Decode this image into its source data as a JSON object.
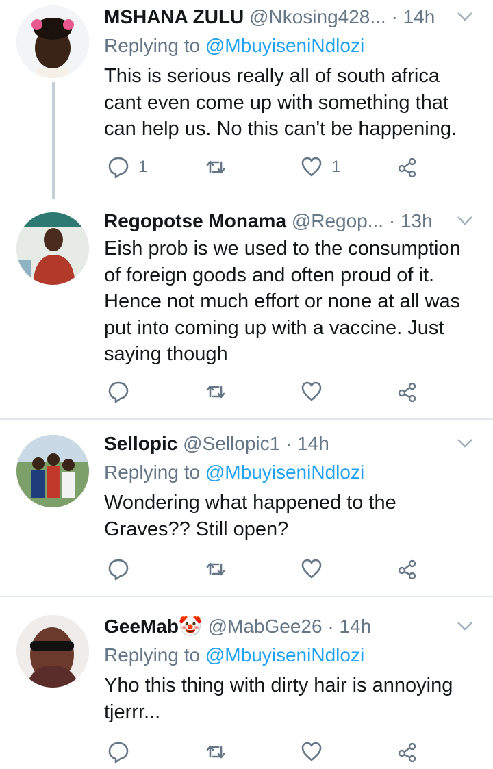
{
  "tweets": [
    {
      "name": "MSHANA ZULU",
      "handle": "@Nkosing428...",
      "dot": "·",
      "time": "14h",
      "replying_prefix": "Replying to",
      "replying_to": "@MbuyiseniNdlozi",
      "text": "This is serious really all of south africa cant even come up with something that can help us. No this can't be happening.",
      "reply_count": "1",
      "retweet_count": "",
      "like_count": "1"
    },
    {
      "name": "Regopotse Monama",
      "handle": "@Regop...",
      "dot": "·",
      "time": "13h",
      "text": "Eish prob is we used to the consumption of foreign goods and often proud of it. Hence not much effort or none at all was put into coming up with a vaccine. Just saying though",
      "reply_count": "",
      "retweet_count": "",
      "like_count": ""
    },
    {
      "name": "Sellopic",
      "handle": "@Sellopic1",
      "dot": "·",
      "time": "14h",
      "replying_prefix": "Replying to",
      "replying_to": "@MbuyiseniNdlozi",
      "text": "Wondering what happened to the Graves?? Still open?",
      "reply_count": "",
      "retweet_count": "",
      "like_count": ""
    },
    {
      "name": "GeeMab🤡",
      "handle": "@MabGee26",
      "dot": "·",
      "time": "14h",
      "replying_prefix": "Replying to",
      "replying_to": "@MbuyiseniNdlozi",
      "text": "Yho this thing with dirty hair is annoying tjerrr...",
      "reply_count": "",
      "retweet_count": "",
      "like_count": ""
    }
  ],
  "colors": {
    "name": "#14171a",
    "secondary": "#657786",
    "mention": "#1da1f2",
    "divider": "#e1e8ed",
    "thread_line": "#c4cfd6"
  }
}
